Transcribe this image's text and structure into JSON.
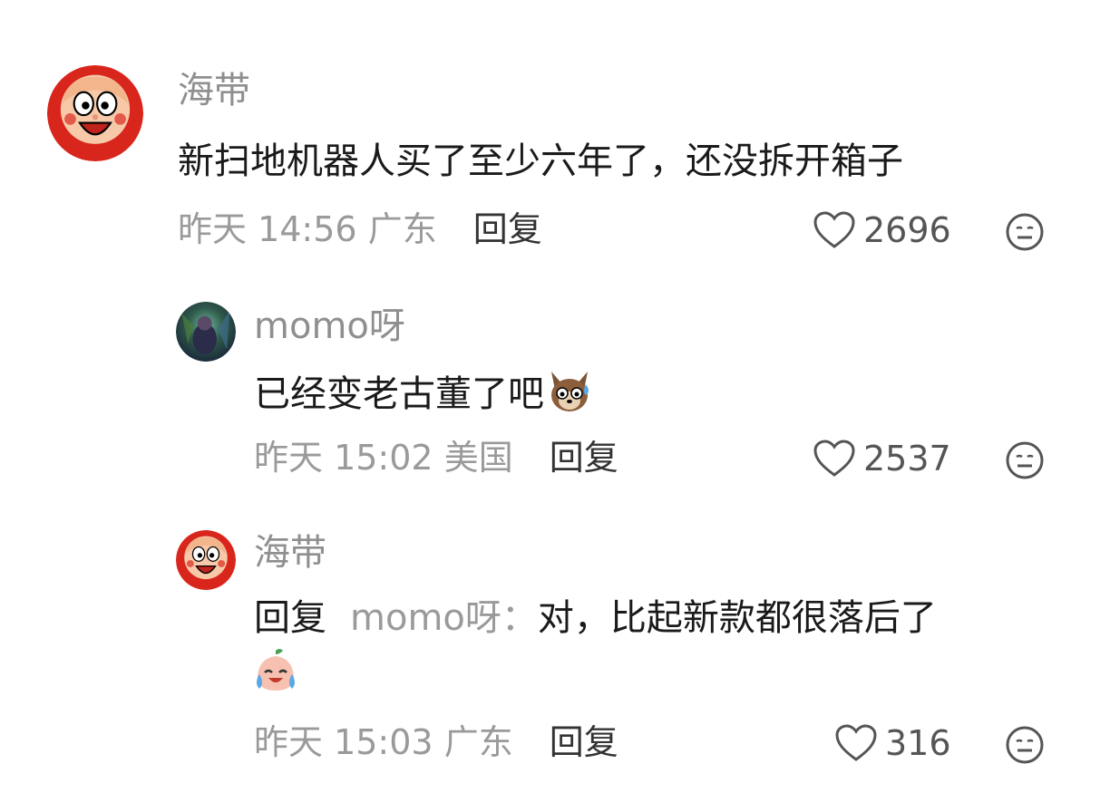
{
  "comments": [
    {
      "user": "海带",
      "text": "新扫地机器人买了至少六年了，还没拆开箱子",
      "time": "昨天 14:56",
      "location": "广东",
      "reply_label": "回复",
      "likes": "2696",
      "icon": "neutral-face-icon"
    },
    {
      "user": "momo呀",
      "text": "已经变老古董了吧",
      "emoji": "sweating-dog-emoji",
      "time": "昨天 15:02",
      "location": "美国",
      "reply_label": "回复",
      "likes": "2537",
      "icon": "neutral-face-icon"
    },
    {
      "user": "海带",
      "reply_prefix": "回复",
      "reply_to": "momo呀：",
      "text": "对，比起新款都很落后了",
      "emoji": "crying-laughing-emoji",
      "time": "昨天 15:03",
      "location": "广东",
      "reply_label": "回复",
      "likes": "316",
      "icon": "neutral-face-icon"
    }
  ],
  "colors": {
    "muted": "#9a9a9a",
    "text": "#1a1a1a",
    "avatar_bg": "#d9261c"
  }
}
